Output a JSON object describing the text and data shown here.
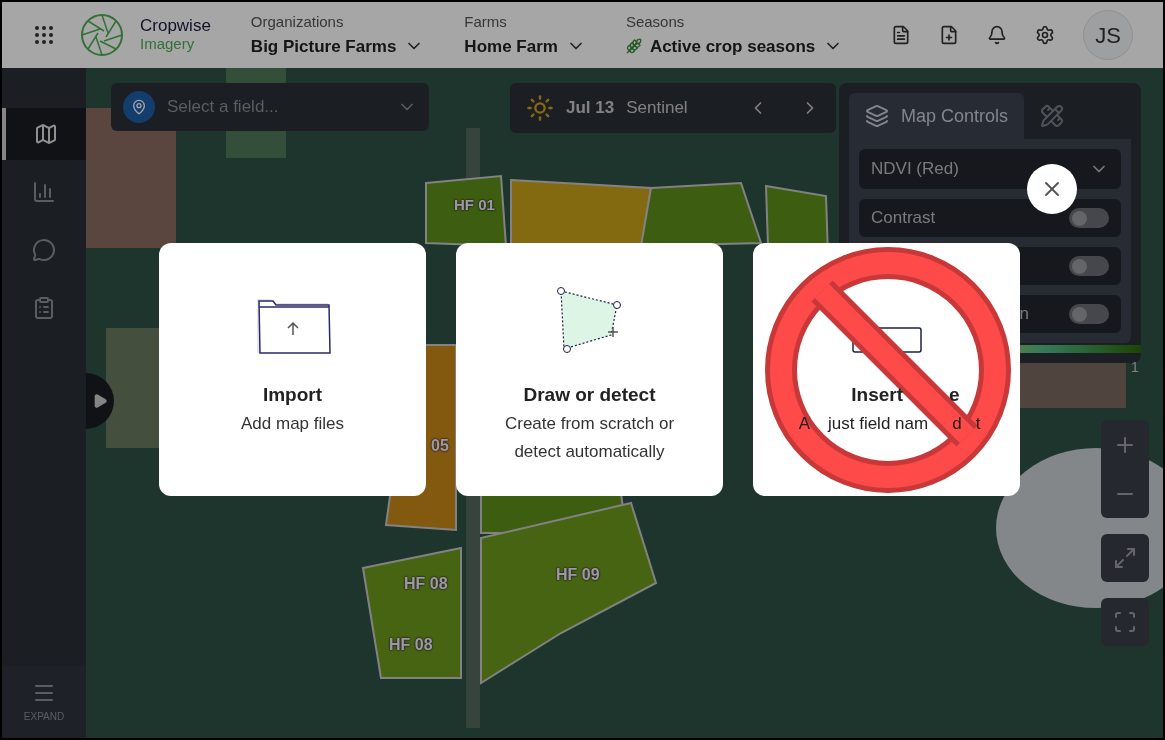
{
  "header": {
    "app_name": "Cropwise",
    "app_subtitle": "Imagery",
    "selectors": [
      {
        "label": "Organizations",
        "value": "Big Picture Farms",
        "kind": "plain"
      },
      {
        "label": "Farms",
        "value": "Home Farm",
        "kind": "plain"
      },
      {
        "label": "Seasons",
        "value": "Active crop seasons",
        "kind": "crop"
      }
    ],
    "avatar": "JS"
  },
  "sidebar": {
    "items": [
      {
        "selected": true
      },
      {
        "selected": false
      },
      {
        "selected": false
      },
      {
        "selected": false
      }
    ],
    "expand_label": "EXPAND"
  },
  "field_select": {
    "placeholder": "Select a field..."
  },
  "imagery_bar": {
    "date": "Jul 13",
    "source": "Sentinel"
  },
  "map_controls": {
    "tabs": [
      {
        "label": "Map Controls",
        "selected": true
      },
      {
        "selected": false
      }
    ],
    "layer": "NDVI (Red)",
    "toggles": [
      {
        "label": "Contrast",
        "on": false
      },
      {
        "on": false
      },
      {
        "label": "n",
        "on": false
      }
    ],
    "legend_max": "1"
  },
  "map_labels": [
    {
      "text": "HF 01"
    },
    {
      "text": "05"
    },
    {
      "text": "HF 08"
    },
    {
      "text": "HF 09"
    },
    {
      "text": "HF 08"
    }
  ],
  "cards": [
    {
      "title": "Import",
      "subtitle": "Add map files",
      "kind": "import"
    },
    {
      "title": "Draw or detect",
      "subtitle": "Create from scratch or detect automatically",
      "kind": "draw"
    },
    {
      "title_parts": [
        "Insert",
        "e"
      ],
      "subtitle_parts": [
        "A",
        "just field nam",
        "d",
        "t"
      ],
      "kind": "insert",
      "blocked": true
    }
  ]
}
